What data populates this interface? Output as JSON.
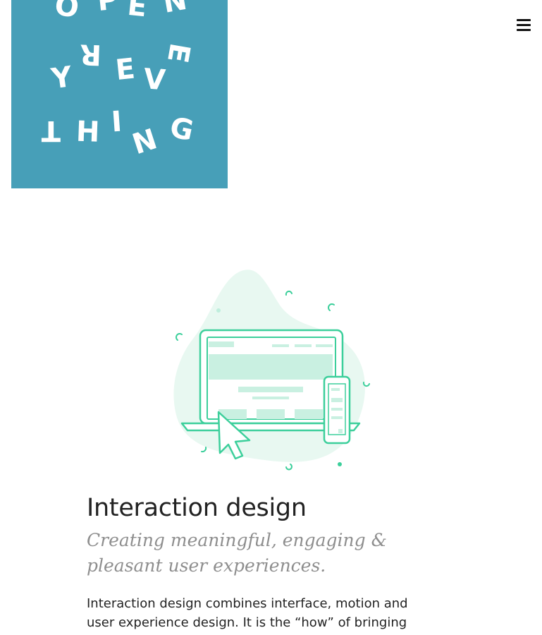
{
  "logo": {
    "text": "OPEN EVERYTHING",
    "letters": [
      "O",
      "P",
      "E",
      "N",
      "Y",
      "R",
      "E",
      "V",
      "E",
      "T",
      "H",
      "I",
      "N",
      "G"
    ],
    "background_color": "#479fb8",
    "letter_color": "#ffffff"
  },
  "header": {
    "menu_icon": "hamburger-menu-icon"
  },
  "illustration": {
    "icon": "responsive-devices-illustration",
    "accent_color": "#3ccf9b",
    "fill_color": "#c9f0e1",
    "blob_color": "#e8f8f1"
  },
  "section": {
    "title": "Interaction design",
    "subtitle": "Creating meaningful, engaging & pleasant user experiences.",
    "body": "Interaction design combines interface, motion and user experience design. It is the “how” of bringing information to"
  }
}
